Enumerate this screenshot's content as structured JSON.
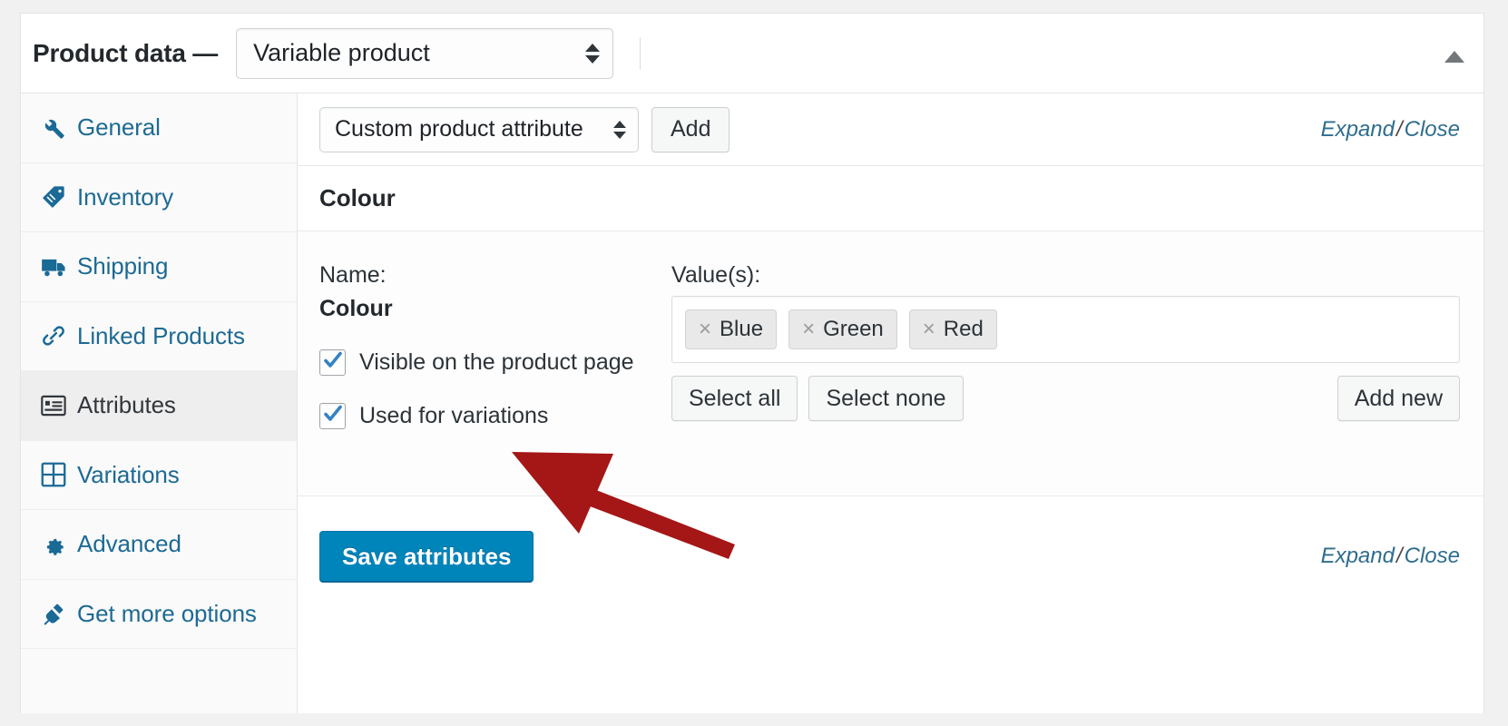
{
  "header": {
    "title": "Product data —",
    "product_type": "Variable product",
    "collapse_icon": "triangle-up-icon"
  },
  "sidebar": {
    "items": [
      {
        "label": "General",
        "icon": "wrench-icon",
        "active": false
      },
      {
        "label": "Inventory",
        "icon": "tag-icon",
        "active": false
      },
      {
        "label": "Shipping",
        "icon": "truck-icon",
        "active": false
      },
      {
        "label": "Linked Products",
        "icon": "link-icon",
        "active": false
      },
      {
        "label": "Attributes",
        "icon": "list-icon",
        "active": true
      },
      {
        "label": "Variations",
        "icon": "grid-icon",
        "active": false
      },
      {
        "label": "Advanced",
        "icon": "gear-icon",
        "active": false
      },
      {
        "label": "Get more options",
        "icon": "plug-icon",
        "active": false
      }
    ]
  },
  "toolbar": {
    "attribute_select": "Custom product attribute",
    "add_label": "Add",
    "expand_label": "Expand",
    "separator": "/",
    "close_label": "Close"
  },
  "attribute": {
    "heading": "Colour",
    "name_label": "Name:",
    "name_value": "Colour",
    "visible_checkbox": {
      "label": "Visible on the product page",
      "checked": true
    },
    "variations_checkbox": {
      "label": "Used for variations",
      "checked": true
    },
    "values_label": "Value(s):",
    "tokens": [
      "Blue",
      "Green",
      "Red"
    ],
    "remove_glyph": "×",
    "select_all_label": "Select all",
    "select_none_label": "Select none",
    "add_new_label": "Add new"
  },
  "footer": {
    "save_label": "Save attributes",
    "expand_label": "Expand",
    "separator": "/",
    "close_label": "Close"
  },
  "annotation": {
    "type": "arrow",
    "color": "#a51616",
    "points_to": "Used for variations"
  },
  "colors": {
    "link_blue": "#1d6a93",
    "primary_button": "#0085ba",
    "active_tab_bg": "#eeeeee",
    "annotation_red": "#a51616",
    "checkbox_check": "#3582c4"
  }
}
